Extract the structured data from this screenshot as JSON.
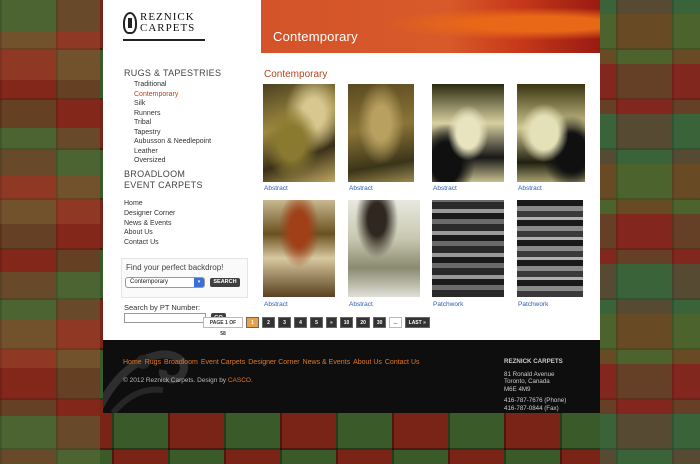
{
  "logo": {
    "line1": "REZNICK",
    "line2": "CARPETS"
  },
  "banner": {
    "title": "Contemporary"
  },
  "sidebar": {
    "categories": [
      {
        "label": "RUGS & TAPESTRIES"
      },
      {
        "label": "BROADLOOM"
      },
      {
        "label": "EVENT CARPETS"
      }
    ],
    "rug_subitems": [
      {
        "label": "Traditional"
      },
      {
        "label": "Contemporary",
        "active": true
      },
      {
        "label": "Silk"
      },
      {
        "label": "Runners"
      },
      {
        "label": "Tribal"
      },
      {
        "label": "Tapestry"
      },
      {
        "label": "Aubusson & Needlepoint"
      },
      {
        "label": "Leather"
      },
      {
        "label": "Oversized"
      }
    ],
    "links": [
      {
        "label": "Home"
      },
      {
        "label": "Designer Corner"
      },
      {
        "label": "News & Events"
      },
      {
        "label": "About Us"
      },
      {
        "label": "Contact Us"
      }
    ]
  },
  "backdrop": {
    "title": "Find your perfect backdrop!",
    "selected": "Contemporary",
    "button": "SEARCH"
  },
  "pt_search": {
    "label": "Search by PT Number:",
    "value": "",
    "button": "GO"
  },
  "content": {
    "title": "Contemporary",
    "products": [
      {
        "label": "Abstract",
        "icon": "rug-thumbnail-icon"
      },
      {
        "label": "Abstract",
        "icon": "rug-thumbnail-icon"
      },
      {
        "label": "Abstract",
        "icon": "rug-thumbnail-icon"
      },
      {
        "label": "Abstract",
        "icon": "rug-thumbnail-icon"
      },
      {
        "label": "Abstract",
        "icon": "rug-thumbnail-icon"
      },
      {
        "label": "Abstract",
        "icon": "rug-thumbnail-icon"
      },
      {
        "label": "Patchwork",
        "icon": "rug-thumbnail-icon"
      },
      {
        "label": "Patchwork",
        "icon": "rug-thumbnail-icon"
      }
    ]
  },
  "pager": {
    "info": "PAGE 1 OF 58",
    "pages": [
      "1",
      "2",
      "3",
      "4",
      "5",
      "»",
      "10",
      "20",
      "30",
      "...",
      "LAST »"
    ],
    "current": "1"
  },
  "footer": {
    "links": [
      {
        "label": "Home"
      },
      {
        "label": "Rugs"
      },
      {
        "label": "Broadloom"
      },
      {
        "label": "Event Carpets"
      },
      {
        "label": "Designer Corner"
      },
      {
        "label": "News & Events"
      },
      {
        "label": "About Us"
      },
      {
        "label": "Contact Us"
      }
    ],
    "copyright": "© 2012 Reznick Carpets. Design by",
    "designer": "CASCO.",
    "address": {
      "name": "REZNICK CARPETS",
      "street": "81 Ronald Avenue",
      "city": "Toronto, Canada",
      "postal": "M6E 4M9",
      "phone": "416-787-7676 (Phone)",
      "fax": "416-787-0844 (Fax)"
    }
  },
  "colors": {
    "accent": "#b5451b",
    "link": "#2a5db0",
    "footer_link": "#e07828",
    "banner": "#d4532a"
  }
}
